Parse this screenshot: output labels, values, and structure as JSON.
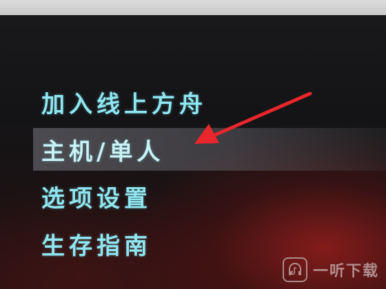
{
  "menu": {
    "items": [
      {
        "label": "加入线上方舟",
        "selected": false
      },
      {
        "label": "主机/单人",
        "selected": true
      },
      {
        "label": "选项设置",
        "selected": false
      },
      {
        "label": "生存指南",
        "selected": false
      }
    ]
  },
  "colors": {
    "menu_text": "#8fe6f0",
    "highlight": "#77777f",
    "arrow": "#e8262c",
    "accent_red": "#961e1c"
  },
  "watermark": {
    "logo_icon": "headphone-music-logo-icon",
    "text": "一听下载"
  }
}
